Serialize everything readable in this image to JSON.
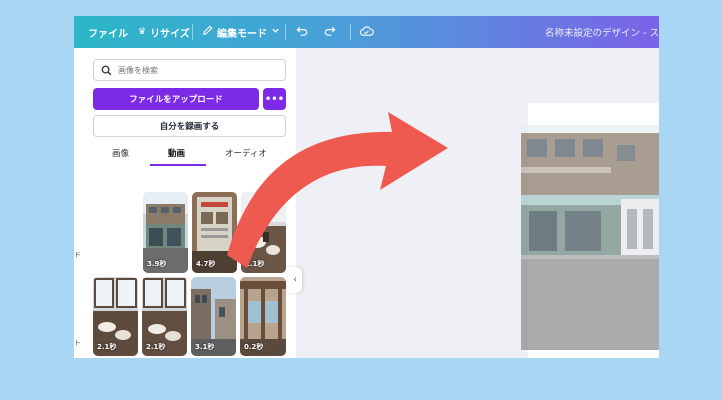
{
  "topbar": {
    "file_label": "ファイル",
    "resize_label": "リサイズ",
    "edit_mode_label": "編集モード",
    "doc_title": "名称未設定のデザイン - ス",
    "icons": [
      "crown-icon",
      "pencil-icon",
      "chevron-down-icon",
      "undo-icon",
      "redo-icon",
      "cloud-check-icon"
    ]
  },
  "sidebar_stripe": {
    "labels": [
      "ド",
      "ト"
    ]
  },
  "panel": {
    "search_placeholder": "画像を検索",
    "upload_label": "ファイルをアップロード",
    "more_label": "•••",
    "record_label": "自分を録画する",
    "tabs": [
      {
        "label": "画像",
        "active": false
      },
      {
        "label": "動画",
        "active": true
      },
      {
        "label": "オーディオ",
        "active": false
      }
    ],
    "videos": [
      {
        "duration": "3.9秒"
      },
      {
        "duration": "4.7秒"
      },
      {
        "duration": "2.1秒"
      },
      {
        "duration": "2.1秒"
      },
      {
        "duration": "2.1秒"
      },
      {
        "duration": "3.1秒"
      },
      {
        "duration": "0.2秒"
      }
    ],
    "collapse_label": "‹"
  },
  "colors": {
    "accent": "#7d2ae8",
    "arrow": "#ef5a50",
    "background": "#a9d6f2",
    "canvas": "#eef0f6"
  }
}
